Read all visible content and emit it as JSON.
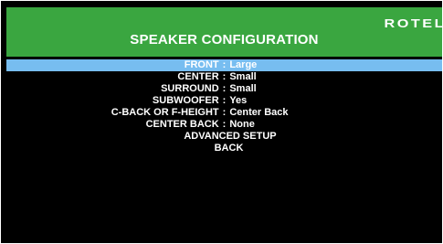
{
  "header": {
    "title": "SPEAKER CONFIGURATION",
    "brand": "ROTEL"
  },
  "colors": {
    "header_bg": "#3aa640",
    "selected_bg": "#77bdf0",
    "screen_bg": "#000000",
    "text": "#ffffff"
  },
  "menu": {
    "separator": ":",
    "items": [
      {
        "label": "FRONT",
        "value": "Large"
      },
      {
        "label": "CENTER",
        "value": "Small"
      },
      {
        "label": "SURROUND",
        "value": "Small"
      },
      {
        "label": "SUBWOOFER",
        "value": "Yes"
      },
      {
        "label": "C-BACK OR F-HEIGHT",
        "value": "Center Back"
      },
      {
        "label": "CENTER BACK",
        "value": "None"
      }
    ],
    "advanced_label": "ADVANCED SETUP",
    "back_label": "BACK",
    "selected_index": 0
  }
}
